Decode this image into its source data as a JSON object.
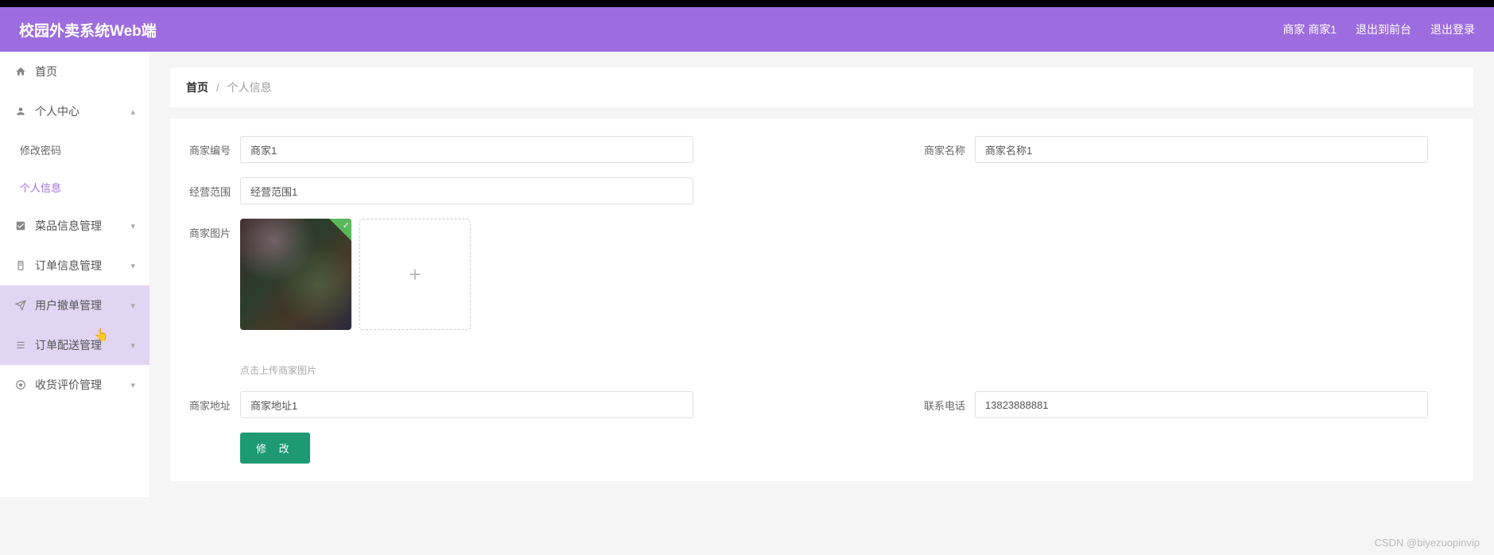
{
  "header": {
    "title": "校园外卖系统Web端",
    "user_label": "商家 商家1",
    "logout_front": "退出到前台",
    "logout": "退出登录"
  },
  "sidebar": {
    "items": [
      {
        "icon": "home-icon",
        "label": "首页",
        "expandable": false
      },
      {
        "icon": "user-icon",
        "label": "个人中心",
        "expandable": true,
        "open": true,
        "chevron": "up"
      },
      {
        "icon": "check-square-icon",
        "label": "菜品信息管理",
        "expandable": true,
        "chevron": "down"
      },
      {
        "icon": "doc-icon",
        "label": "订单信息管理",
        "expandable": true,
        "chevron": "down"
      },
      {
        "icon": "send-icon",
        "label": "用户撤单管理",
        "expandable": true,
        "chevron": "down",
        "highlight": true
      },
      {
        "icon": "list-icon",
        "label": "订单配送管理",
        "expandable": true,
        "chevron": "down",
        "highlight": true
      },
      {
        "icon": "star-circle-icon",
        "label": "收货评价管理",
        "expandable": true,
        "chevron": "down"
      }
    ],
    "subs": [
      {
        "label": "修改密码",
        "active": false
      },
      {
        "label": "个人信息",
        "active": true
      }
    ]
  },
  "breadcrumb": {
    "home": "首页",
    "current": "个人信息",
    "sep": "/"
  },
  "form": {
    "labels": {
      "merchant_no": "商家编号",
      "merchant_name": "商家名称",
      "business_scope": "经营范围",
      "merchant_image": "商家图片",
      "merchant_address": "商家地址",
      "contact_phone": "联系电话"
    },
    "values": {
      "merchant_no": "商家1",
      "merchant_name": "商家名称1",
      "business_scope": "经营范围1",
      "merchant_address": "商家地址1",
      "contact_phone": "13823888881"
    },
    "upload_hint": "点击上传商家图片",
    "submit_label": "修 改"
  },
  "watermark": "CSDN @biyezuopinvip"
}
